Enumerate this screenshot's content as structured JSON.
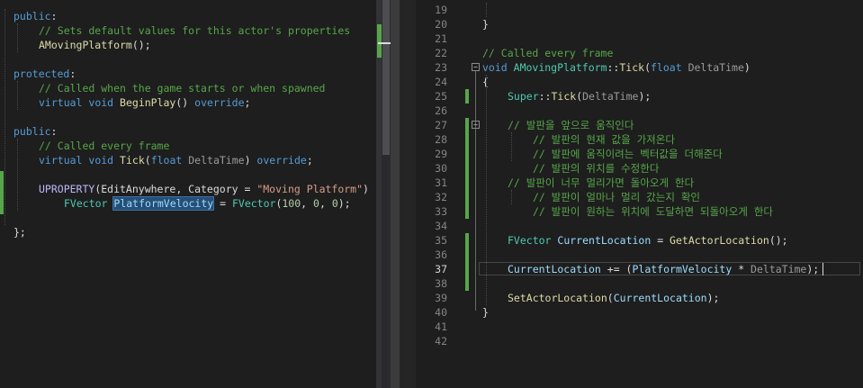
{
  "left_editor": {
    "lines": [
      {
        "indent": 0,
        "tokens": [
          {
            "c": "kw",
            "t": "public"
          },
          {
            "c": "plain",
            "t": ":"
          }
        ]
      },
      {
        "indent": 2,
        "tokens": [
          {
            "c": "cm",
            "t": "// Sets default values for this actor's properties"
          }
        ]
      },
      {
        "indent": 2,
        "tokens": [
          {
            "c": "fn",
            "t": "AMovingPlatform"
          },
          {
            "c": "plain",
            "t": "();"
          }
        ]
      },
      {
        "indent": 0,
        "tokens": []
      },
      {
        "indent": 0,
        "tokens": [
          {
            "c": "kw",
            "t": "protected"
          },
          {
            "c": "plain",
            "t": ":"
          }
        ]
      },
      {
        "indent": 2,
        "tokens": [
          {
            "c": "cm",
            "t": "// Called when the game starts or when spawned"
          }
        ]
      },
      {
        "indent": 2,
        "tokens": [
          {
            "c": "kw",
            "t": "virtual"
          },
          {
            "c": "plain",
            "t": " "
          },
          {
            "c": "kw",
            "t": "void"
          },
          {
            "c": "plain",
            "t": " "
          },
          {
            "c": "fn",
            "t": "BeginPlay"
          },
          {
            "c": "plain",
            "t": "() "
          },
          {
            "c": "kw",
            "t": "override"
          },
          {
            "c": "plain",
            "t": ";"
          }
        ]
      },
      {
        "indent": 0,
        "tokens": []
      },
      {
        "indent": 0,
        "tokens": [
          {
            "c": "kw",
            "t": "public"
          },
          {
            "c": "plain",
            "t": ":"
          }
        ]
      },
      {
        "indent": 2,
        "tokens": [
          {
            "c": "cm",
            "t": "// Called every frame"
          }
        ]
      },
      {
        "indent": 2,
        "tokens": [
          {
            "c": "kw",
            "t": "virtual"
          },
          {
            "c": "plain",
            "t": " "
          },
          {
            "c": "kw",
            "t": "void"
          },
          {
            "c": "plain",
            "t": " "
          },
          {
            "c": "fn",
            "t": "Tick"
          },
          {
            "c": "plain",
            "t": "("
          },
          {
            "c": "kw",
            "t": "float"
          },
          {
            "c": "plain",
            "t": " "
          },
          {
            "c": "pm",
            "t": "DeltaTime"
          },
          {
            "c": "plain",
            "t": ") "
          },
          {
            "c": "kw",
            "t": "override"
          },
          {
            "c": "plain",
            "t": ";"
          }
        ]
      },
      {
        "indent": 0,
        "tokens": []
      },
      {
        "indent": 2,
        "tokens": [
          {
            "c": "mc",
            "t": "UPROPERTY"
          },
          {
            "c": "plain",
            "t": "(EditAnywhere, Category = "
          },
          {
            "c": "st",
            "t": "\"Moving Platform\""
          },
          {
            "c": "plain",
            "t": ")"
          }
        ]
      },
      {
        "indent": 4,
        "tokens": [
          {
            "c": "ty",
            "t": "FVector"
          },
          {
            "c": "plain",
            "t": " "
          },
          {
            "c": "va sel",
            "t": "PlatformVelocity"
          },
          {
            "c": "plain",
            "t": " = "
          },
          {
            "c": "ty",
            "t": "FVector"
          },
          {
            "c": "plain",
            "t": "("
          },
          {
            "c": "nu",
            "t": "100"
          },
          {
            "c": "plain",
            "t": ", "
          },
          {
            "c": "nu",
            "t": "0"
          },
          {
            "c": "plain",
            "t": ", "
          },
          {
            "c": "nu",
            "t": "0"
          },
          {
            "c": "plain",
            "t": ");"
          }
        ]
      },
      {
        "indent": 0,
        "tokens": []
      },
      {
        "indent": 0,
        "tokens": [
          {
            "c": "plain",
            "t": "};"
          }
        ]
      }
    ]
  },
  "right_editor": {
    "current_line": "37",
    "lines": [
      {
        "no": "19",
        "indent": 0,
        "tokens": []
      },
      {
        "no": "20",
        "indent": 0,
        "tokens": [
          {
            "c": "plain",
            "t": "}"
          }
        ]
      },
      {
        "no": "21",
        "indent": 0,
        "tokens": []
      },
      {
        "no": "22",
        "indent": 0,
        "tokens": [
          {
            "c": "cm",
            "t": "// Called every frame"
          }
        ]
      },
      {
        "no": "23",
        "indent": 0,
        "tokens": [
          {
            "c": "kw",
            "t": "void"
          },
          {
            "c": "plain",
            "t": " "
          },
          {
            "c": "ty",
            "t": "AMovingPlatform"
          },
          {
            "c": "plain",
            "t": "::"
          },
          {
            "c": "fn",
            "t": "Tick"
          },
          {
            "c": "plain",
            "t": "("
          },
          {
            "c": "kw",
            "t": "float"
          },
          {
            "c": "plain",
            "t": " "
          },
          {
            "c": "pm",
            "t": "DeltaTime"
          },
          {
            "c": "plain",
            "t": ")"
          }
        ]
      },
      {
        "no": "24",
        "indent": 0,
        "tokens": [
          {
            "c": "plain",
            "t": "{"
          }
        ]
      },
      {
        "no": "25",
        "indent": 2,
        "tokens": [
          {
            "c": "ty",
            "t": "Super"
          },
          {
            "c": "plain",
            "t": "::"
          },
          {
            "c": "fn",
            "t": "Tick"
          },
          {
            "c": "plain",
            "t": "("
          },
          {
            "c": "pm",
            "t": "DeltaTime"
          },
          {
            "c": "plain",
            "t": ");"
          }
        ]
      },
      {
        "no": "26",
        "indent": 0,
        "tokens": []
      },
      {
        "no": "27",
        "indent": 2,
        "tokens": [
          {
            "c": "cm",
            "t": "// 발판을 앞으로 움직인다"
          }
        ]
      },
      {
        "no": "28",
        "indent": 4,
        "tokens": [
          {
            "c": "cm",
            "t": "// 발판의 현재 값을 가져온다"
          }
        ]
      },
      {
        "no": "29",
        "indent": 4,
        "tokens": [
          {
            "c": "cm",
            "t": "// 발판에 움직이려는 벡터값을 더해준다"
          }
        ]
      },
      {
        "no": "30",
        "indent": 4,
        "tokens": [
          {
            "c": "cm",
            "t": "// 발판의 위치를 수정한다"
          }
        ]
      },
      {
        "no": "31",
        "indent": 2,
        "tokens": [
          {
            "c": "cm",
            "t": "// 발판이 너무 멀리가면 돌아오게 한다"
          }
        ]
      },
      {
        "no": "32",
        "indent": 4,
        "tokens": [
          {
            "c": "cm",
            "t": "// 발판이 얼마나 멀리 갔는지 확인"
          }
        ]
      },
      {
        "no": "33",
        "indent": 4,
        "tokens": [
          {
            "c": "cm",
            "t": "// 발판이 원하는 위치에 도달하면 되돌아오게 한다"
          }
        ]
      },
      {
        "no": "34",
        "indent": 0,
        "tokens": []
      },
      {
        "no": "35",
        "indent": 2,
        "tokens": [
          {
            "c": "ty",
            "t": "FVector"
          },
          {
            "c": "plain",
            "t": " "
          },
          {
            "c": "va",
            "t": "CurrentLocation"
          },
          {
            "c": "plain",
            "t": " = "
          },
          {
            "c": "fn",
            "t": "GetActorLocation"
          },
          {
            "c": "plain",
            "t": "();"
          }
        ]
      },
      {
        "no": "36",
        "indent": 0,
        "tokens": []
      },
      {
        "no": "37",
        "indent": 2,
        "tokens": [
          {
            "c": "va",
            "t": "CurrentLocation"
          },
          {
            "c": "plain",
            "t": " += ("
          },
          {
            "c": "va",
            "t": "PlatformVelocity"
          },
          {
            "c": "plain",
            "t": " * "
          },
          {
            "c": "pm",
            "t": "DeltaTime"
          },
          {
            "c": "plain",
            "t": ");"
          }
        ]
      },
      {
        "no": "38",
        "indent": 0,
        "tokens": []
      },
      {
        "no": "39",
        "indent": 2,
        "tokens": [
          {
            "c": "fn",
            "t": "SetActorLocation"
          },
          {
            "c": "plain",
            "t": "("
          },
          {
            "c": "va",
            "t": "CurrentLocation"
          },
          {
            "c": "plain",
            "t": ");"
          }
        ]
      },
      {
        "no": "40",
        "indent": 0,
        "tokens": [
          {
            "c": "plain",
            "t": "}"
          }
        ]
      },
      {
        "no": "41",
        "indent": 0,
        "tokens": []
      },
      {
        "no": "42",
        "indent": 0,
        "tokens": []
      }
    ]
  },
  "colors": {
    "editor_background": "#1e1e1e",
    "keyword": "#569cd6",
    "comment": "#57a64a",
    "type": "#4ec9b0",
    "function": "#dcdcaa",
    "string": "#d69d85",
    "change_marker": "#57a64a"
  }
}
